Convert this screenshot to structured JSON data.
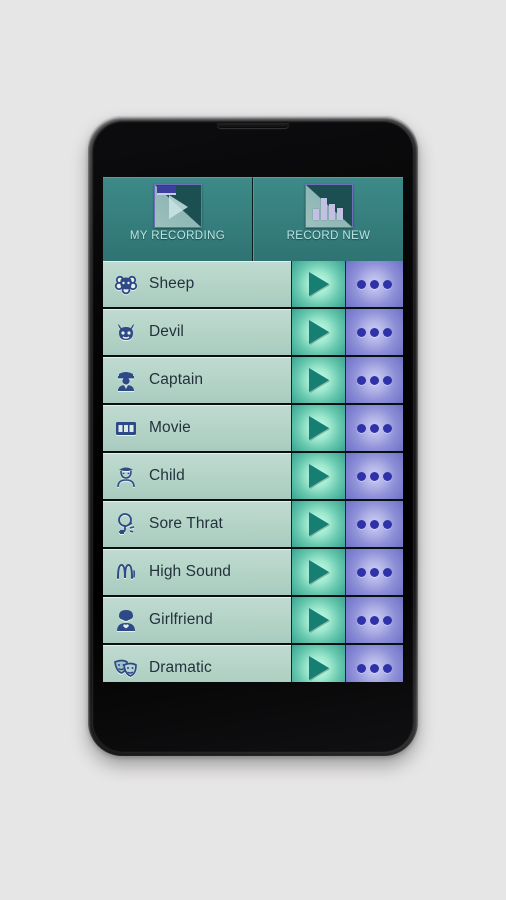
{
  "app": {
    "background_color": "#e7e6e6",
    "screen_background": "#000000",
    "accent_teal": "#37807f",
    "row_background": "#b4d3c7",
    "play_button_color": "#39a394",
    "menu_button_color": "#8e90d8",
    "icon_color": "#2e4a86"
  },
  "tabs": [
    {
      "label": "MY RECORDING",
      "icon": "play-tab-icon",
      "selected": true
    },
    {
      "label": "RECORD NEW",
      "icon": "equalizer-tab-icon",
      "selected": false
    }
  ],
  "list": {
    "play_icon": "play-icon",
    "menu_icon": "more-options-icon",
    "items": [
      {
        "label": "Sheep",
        "icon": "sheep-icon"
      },
      {
        "label": "Devil",
        "icon": "devil-icon"
      },
      {
        "label": "Captain",
        "icon": "captain-icon"
      },
      {
        "label": "Movie",
        "icon": "movie-icon"
      },
      {
        "label": "Child",
        "icon": "child-icon"
      },
      {
        "label": "Sore Thrat",
        "icon": "sore-throat-icon"
      },
      {
        "label": "High Sound",
        "icon": "waveform-icon"
      },
      {
        "label": "Girlfriend",
        "icon": "girlfriend-icon"
      },
      {
        "label": "Dramatic",
        "icon": "theater-masks-icon"
      }
    ]
  }
}
